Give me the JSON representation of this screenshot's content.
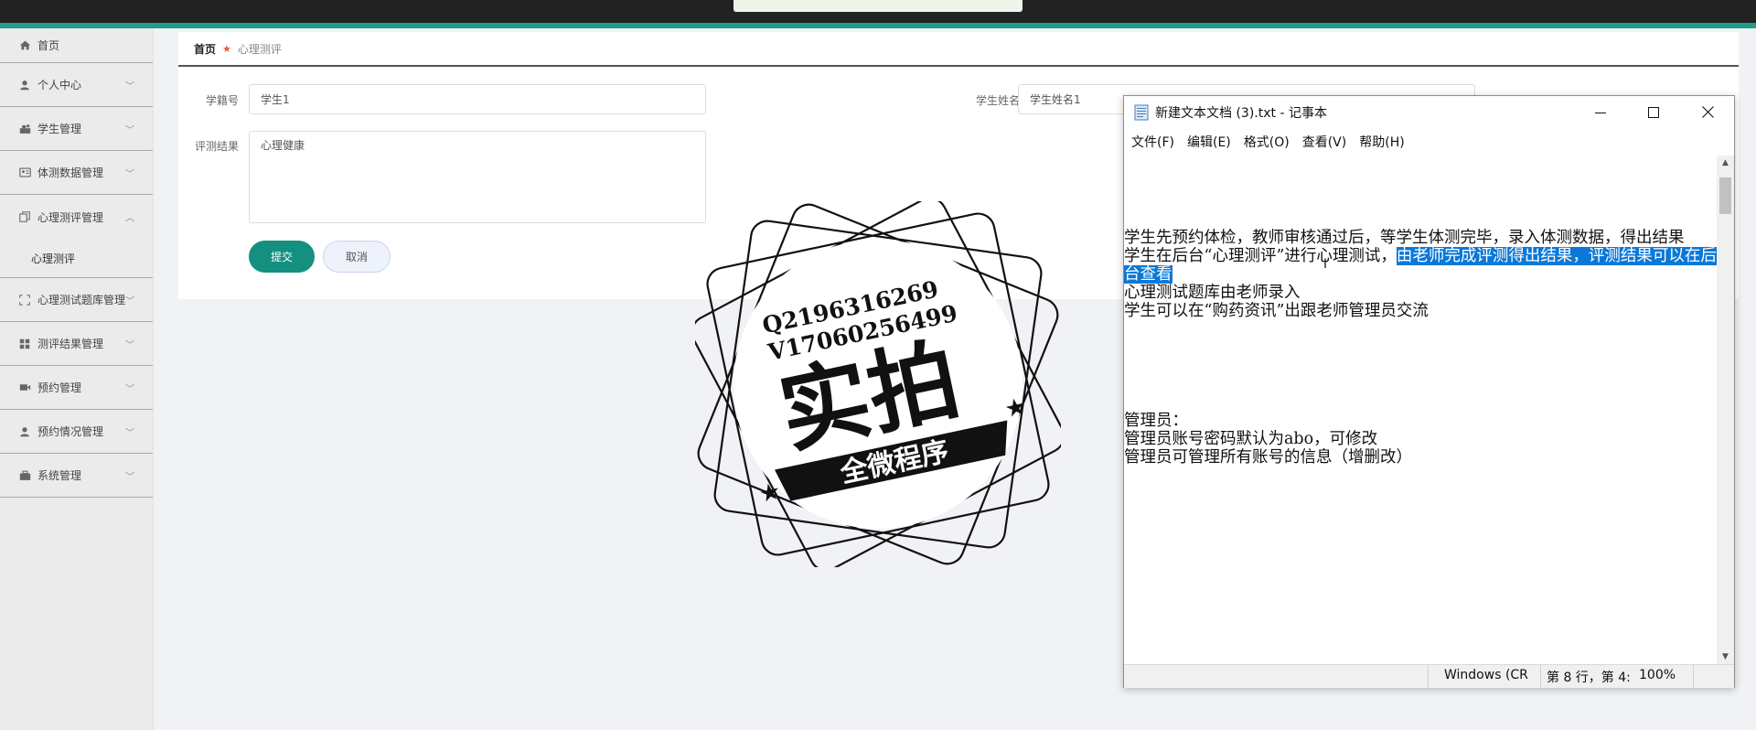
{
  "window": {
    "accent_color": "#1e9e88"
  },
  "sidebar": {
    "home": {
      "label": "首页",
      "icon": "home-icon"
    },
    "items": [
      {
        "label": "个人中心",
        "icon": "user-icon"
      },
      {
        "label": "学生管理",
        "icon": "student-icon"
      },
      {
        "label": "体测数据管理",
        "icon": "id-card-icon"
      },
      {
        "label": "心理测评管理",
        "icon": "copy-icon",
        "expanded": true
      }
    ],
    "sub_item": {
      "label": "心理测评"
    },
    "items_after": [
      {
        "label": "心理测试题库管理",
        "icon": "scan-icon"
      },
      {
        "label": "测评结果管理",
        "icon": "grid-icon"
      },
      {
        "label": "预约管理",
        "icon": "video-icon"
      },
      {
        "label": "预约情况管理",
        "icon": "user-icon"
      },
      {
        "label": "系统管理",
        "icon": "briefcase-icon"
      }
    ]
  },
  "breadcrumb": {
    "home": "首页",
    "current": "心理测评"
  },
  "form": {
    "student_id_label": "学籍号",
    "student_id_value": "学生1",
    "student_name_label": "学生姓名",
    "student_name_value": "学生姓名1",
    "result_label": "评测结果",
    "result_value": "心理健康",
    "submit_label": "提交",
    "cancel_label": "取消",
    "primary_color": "#149080"
  },
  "notepad": {
    "title": "新建文本文档 (3).txt - 记事本",
    "menu": [
      "文件(F)",
      "编辑(E)",
      "格式(O)",
      "查看(V)",
      "帮助(H)"
    ],
    "lines": {
      "l1": "学生先预约体检，教师审核通过后，等学生体测完毕，录入体测数据，得出结果",
      "l2a": "学生在后台“心理测评”进行心理测试，",
      "l2b": "由老师完成评测得出结果，评测结果可以在后台查看",
      "l3": "心理测试题库由老师录入",
      "l4": "学生可以在“购药资讯”出跟老师管理员交流",
      "l5": "管理员：",
      "l6": "管理员账号密码默认为abo，可修改",
      "l7": "管理员可管理所有账号的信息（增删改）"
    },
    "status": {
      "encoding": "Windows (CR",
      "position": "第 8 行，第 4:",
      "zoom": "100%"
    },
    "selection_color": "#0a78d7"
  },
  "watermark": {
    "line1": "Q2196316269",
    "line2": "V17060256499",
    "main": "实拍",
    "banner": "全微程序"
  }
}
